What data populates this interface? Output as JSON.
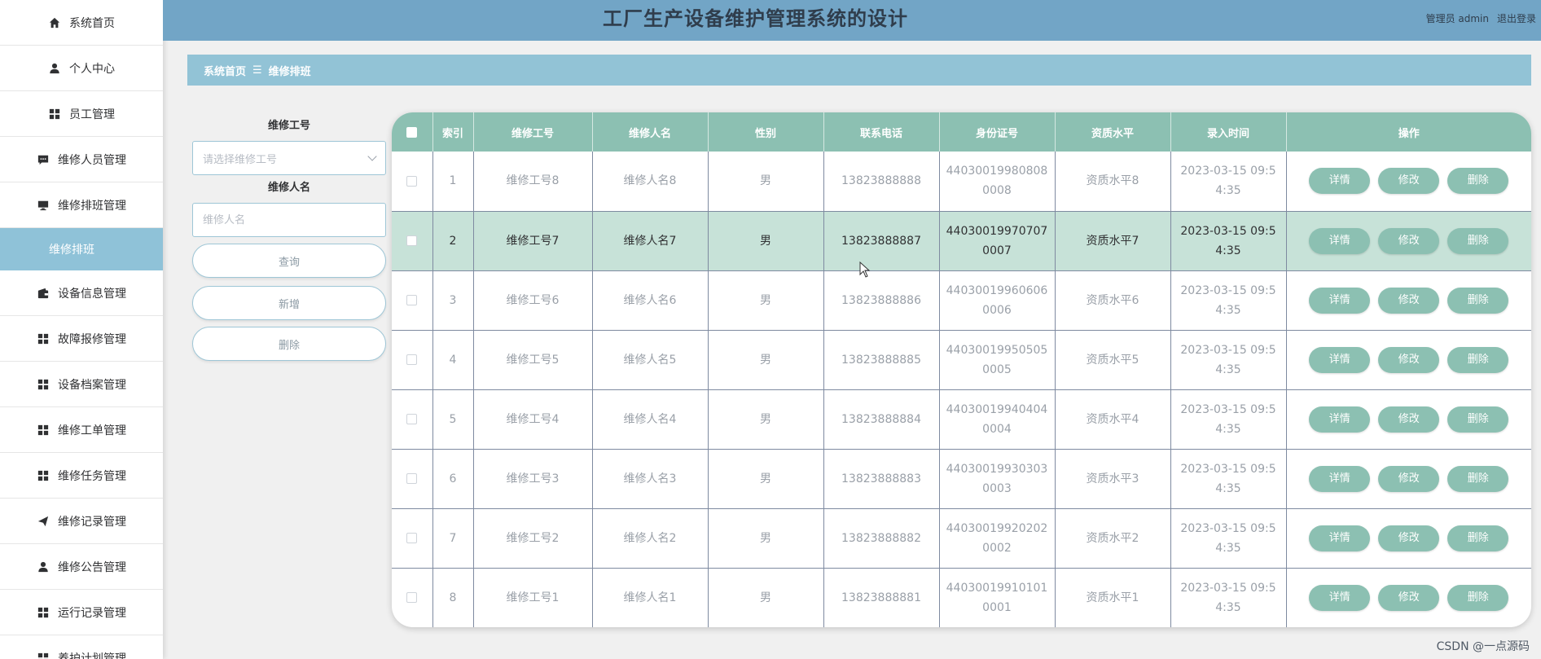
{
  "app": {
    "title": "工厂生产设备维护管理系统的设计"
  },
  "header": {
    "user": "管理员 admin",
    "logout": "退出登录"
  },
  "sidebar": {
    "items": [
      {
        "label": "系统首页",
        "icon": "home-icon"
      },
      {
        "label": "个人中心",
        "icon": "user-icon"
      },
      {
        "label": "员工管理",
        "icon": "grid-icon"
      },
      {
        "label": "维修人员管理",
        "icon": "chat-icon"
      },
      {
        "label": "维修排班管理",
        "icon": "monitor-icon"
      },
      {
        "label": "维修排班",
        "icon": ""
      },
      {
        "label": "设备信息管理",
        "icon": "wallet-icon"
      },
      {
        "label": "故障报修管理",
        "icon": "grid-icon"
      },
      {
        "label": "设备档案管理",
        "icon": "grid-icon"
      },
      {
        "label": "维修工单管理",
        "icon": "grid-icon"
      },
      {
        "label": "维修任务管理",
        "icon": "grid-icon"
      },
      {
        "label": "维修记录管理",
        "icon": "send-icon"
      },
      {
        "label": "维修公告管理",
        "icon": "user-icon"
      },
      {
        "label": "运行记录管理",
        "icon": "grid-icon"
      },
      {
        "label": "养护计划管理",
        "icon": "grid-icon"
      }
    ]
  },
  "breadcrumb": {
    "home": "系统首页",
    "separator": "☰",
    "current": "维修排班"
  },
  "search": {
    "worker_no_label": "维修工号",
    "worker_no_placeholder": "请选择维修工号",
    "worker_name_label": "维修人名",
    "worker_name_placeholder": "维修人名",
    "query_button": "查询",
    "add_button": "新增",
    "delete_button": "删除"
  },
  "table": {
    "columns": [
      "索引",
      "维修工号",
      "维修人名",
      "性别",
      "联系电话",
      "身份证号",
      "资质水平",
      "录入时间",
      "操作"
    ],
    "actions": {
      "detail": "详情",
      "edit": "修改",
      "delete": "删除"
    },
    "rows": [
      {
        "index": "1",
        "worker_no": "维修工号8",
        "worker_name": "维修人名8",
        "gender": "男",
        "phone": "13823888888",
        "id_card": "440300199808080008",
        "level": "资质水平8",
        "time": "2023-03-15 09:54:35"
      },
      {
        "index": "2",
        "worker_no": "维修工号7",
        "worker_name": "维修人名7",
        "gender": "男",
        "phone": "13823888887",
        "id_card": "440300199707070007",
        "level": "资质水平7",
        "time": "2023-03-15 09:54:35"
      },
      {
        "index": "3",
        "worker_no": "维修工号6",
        "worker_name": "维修人名6",
        "gender": "男",
        "phone": "13823888886",
        "id_card": "440300199606060006",
        "level": "资质水平6",
        "time": "2023-03-15 09:54:35"
      },
      {
        "index": "4",
        "worker_no": "维修工号5",
        "worker_name": "维修人名5",
        "gender": "男",
        "phone": "13823888885",
        "id_card": "440300199505050005",
        "level": "资质水平5",
        "time": "2023-03-15 09:54:35"
      },
      {
        "index": "5",
        "worker_no": "维修工号4",
        "worker_name": "维修人名4",
        "gender": "男",
        "phone": "13823888884",
        "id_card": "440300199404040004",
        "level": "资质水平4",
        "time": "2023-03-15 09:54:35"
      },
      {
        "index": "6",
        "worker_no": "维修工号3",
        "worker_name": "维修人名3",
        "gender": "男",
        "phone": "13823888883",
        "id_card": "440300199303030003",
        "level": "资质水平3",
        "time": "2023-03-15 09:54:35"
      },
      {
        "index": "7",
        "worker_no": "维修工号2",
        "worker_name": "维修人名2",
        "gender": "男",
        "phone": "13823888882",
        "id_card": "440300199202020002",
        "level": "资质水平2",
        "time": "2023-03-15 09:54:35"
      },
      {
        "index": "8",
        "worker_no": "维修工号1",
        "worker_name": "维修人名1",
        "gender": "男",
        "phone": "13823888881",
        "id_card": "440300199101010001",
        "level": "资质水平1",
        "time": "2023-03-15 09:54:35"
      }
    ]
  },
  "watermark": "CSDN @一点源码",
  "colors": {
    "header": "#72a5c6",
    "accent": "#8cc0b2",
    "breadcrumb": "#92c3d6",
    "highlight_row": "#c7e2d8"
  }
}
